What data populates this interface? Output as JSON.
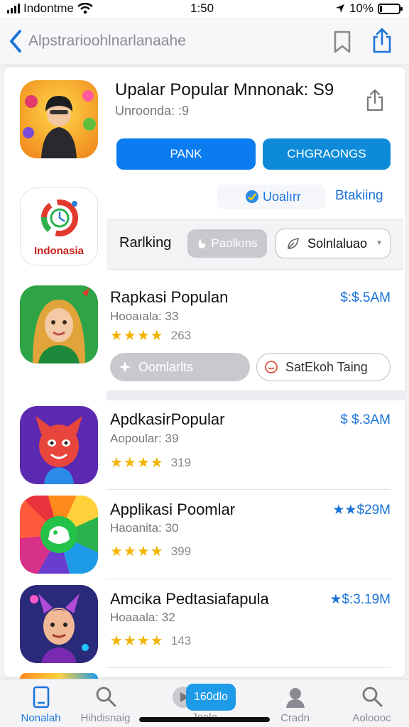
{
  "status_bar": {
    "carrier": "Indontme",
    "time": "1:50",
    "battery": "10%",
    "battery_level": 0.1
  },
  "nav": {
    "title": "Alpstrarioohlnarlanaahe"
  },
  "featured": {
    "title": "Upalar Popular Mnnonak: S9",
    "subtitle": "Unroonda: :9",
    "primary_button": "PANK",
    "secondary_button": "CHGRAONGS",
    "update_chip": "Uoalırr",
    "ranking_link": "Btakiing"
  },
  "logo": {
    "text": "Indonasia"
  },
  "filters": {
    "label": "Rarlking",
    "pill": "Paolkıns",
    "dropdown": "Solnlaluao"
  },
  "apps": [
    {
      "title": "Rapkasi Populan",
      "subtitle": "Hooaıala: 33",
      "rating_count": "263",
      "price": "$:$.5AM",
      "stars": "★★★★",
      "compare": "Oomlarlts",
      "secondary": "SatEkoh Taing"
    },
    {
      "title": "ApdkasirPopular",
      "subtitle": "Aopoular: 39",
      "rating_count": "319",
      "price": "$ $.3AM",
      "stars": "★★★★"
    },
    {
      "title": "Applikasi Poomlar",
      "subtitle": "Haoanita: 30",
      "rating_count": "399",
      "price": "★★$29M",
      "stars": "★★★★"
    },
    {
      "title": "Amcika Pedtasiafapula",
      "subtitle": "Hoaaala: 32",
      "rating_count": "143",
      "price": "★$:3.19M",
      "stars": "★★★★"
    }
  ],
  "tabs": [
    {
      "label": "Nonalah"
    },
    {
      "label": "Hihdisnaig"
    },
    {
      "label": "Jeolo"
    },
    {
      "label": "Cradn"
    },
    {
      "label": "Aoloooc"
    }
  ],
  "play_badge": "160dlo",
  "colors": {
    "accent": "#0a7cf0",
    "star": "#f3b400",
    "link": "#1a73d9"
  }
}
